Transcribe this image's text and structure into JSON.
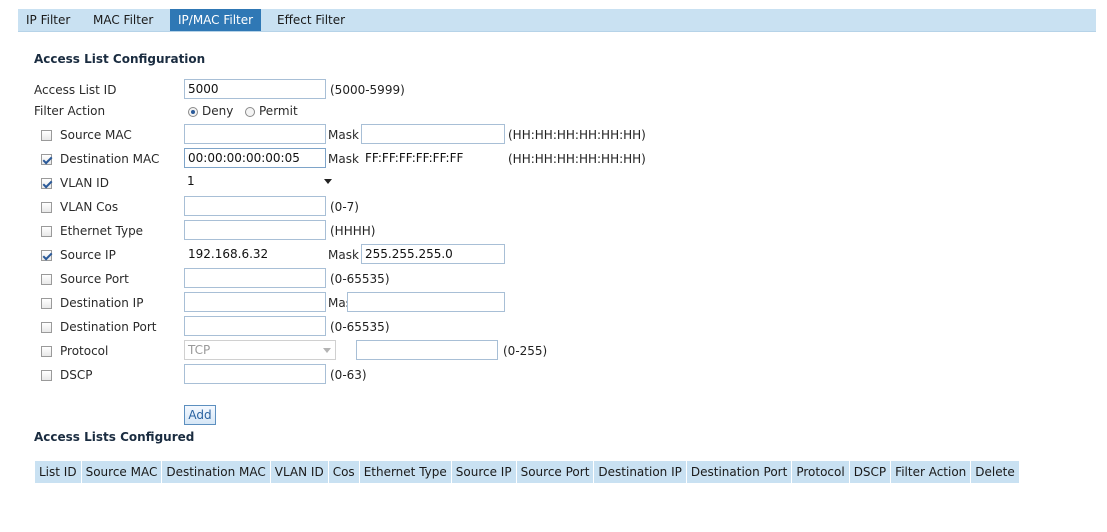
{
  "tabs": [
    "IP Filter",
    "MAC Filter",
    "IP/MAC Filter",
    "Effect Filter"
  ],
  "active_tab": "IP/MAC Filter",
  "config": {
    "title": "Access List Configuration",
    "access_list_id_label": "Access List ID",
    "access_list_id_value": "5000",
    "access_list_id_hint": "(5000-5999)",
    "filter_action_label": "Filter Action",
    "deny_label": "Deny",
    "permit_label": "Permit",
    "selected_action": "Deny",
    "mask_label": "Mask",
    "rows": {
      "source_mac": {
        "label": "Source MAC",
        "checked": false,
        "value": "",
        "mask": "",
        "hint": "(HH:HH:HH:HH:HH:HH)"
      },
      "destination_mac": {
        "label": "Destination MAC",
        "checked": true,
        "value": "00:00:00:00:00:05",
        "mask": "FF:FF:FF:FF:FF:FF",
        "hint": "(HH:HH:HH:HH:HH:HH)"
      },
      "vlan_id": {
        "label": "VLAN ID",
        "checked": true,
        "value": "1"
      },
      "vlan_cos": {
        "label": "VLAN Cos",
        "checked": false,
        "value": "",
        "hint": "(0-7)"
      },
      "ethernet_type": {
        "label": "Ethernet Type",
        "checked": false,
        "value": "",
        "hint": "(HHHH)"
      },
      "source_ip": {
        "label": "Source IP",
        "checked": true,
        "value": "192.168.6.32",
        "mask": "255.255.255.0"
      },
      "source_port": {
        "label": "Source Port",
        "checked": false,
        "value": "",
        "hint": "(0-65535)"
      },
      "destination_ip": {
        "label": "Destination IP",
        "checked": false,
        "value": "",
        "mask": ""
      },
      "destination_port": {
        "label": "Destination Port",
        "checked": false,
        "value": "",
        "hint": "(0-65535)"
      },
      "protocol": {
        "label": "Protocol",
        "checked": false,
        "value": "TCP",
        "number": "",
        "hint": "(0-255)"
      },
      "dscp": {
        "label": "DSCP",
        "checked": false,
        "value": "",
        "hint": "(0-63)"
      }
    },
    "add_button": "Add"
  },
  "lists": {
    "title": "Access Lists Configured",
    "columns": [
      "List ID",
      "Source MAC",
      "Destination MAC",
      "VLAN ID",
      "Cos",
      "Ethernet Type",
      "Source IP",
      "Source Port",
      "Destination IP",
      "Destination Port",
      "Protocol",
      "DSCP",
      "Filter Action",
      "Delete"
    ]
  },
  "colors": {
    "tab_bar": "#c9e1f2",
    "tab_active": "#2f78b5",
    "table_header": "#c9e1f2",
    "button_text": "#2a63a0"
  }
}
